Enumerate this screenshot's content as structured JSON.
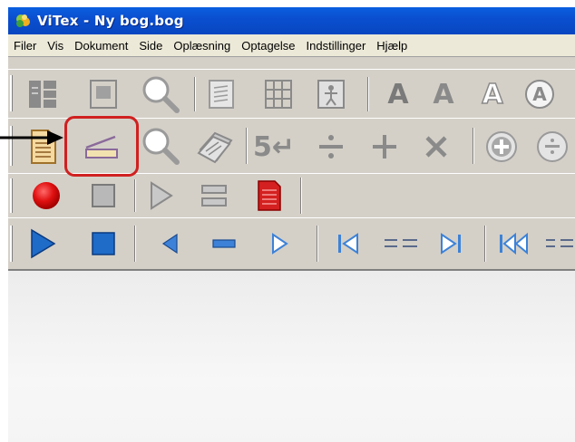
{
  "window": {
    "title": "ViTex - Ny bog.bog",
    "title_color": "#0a4fd0"
  },
  "menu": {
    "items": [
      "Filer",
      "Vis",
      "Dokument",
      "Side",
      "Oplæsning",
      "Optagelse",
      "Indstillinger",
      "Hjælp"
    ]
  },
  "toolbar1": {
    "font_letters": [
      "A",
      "A",
      "A",
      "A"
    ]
  },
  "toolbar2": {
    "page_number_glyph": "5↵"
  },
  "annotation": {
    "highlight_color": "#d02020",
    "highlighted": "scanner-button"
  },
  "colors": {
    "record": "#e01010",
    "play_blue": "#1e6bc8",
    "toolbar_bg": "#d4d0c8",
    "titlebar_blue": "#0a4fd0"
  }
}
